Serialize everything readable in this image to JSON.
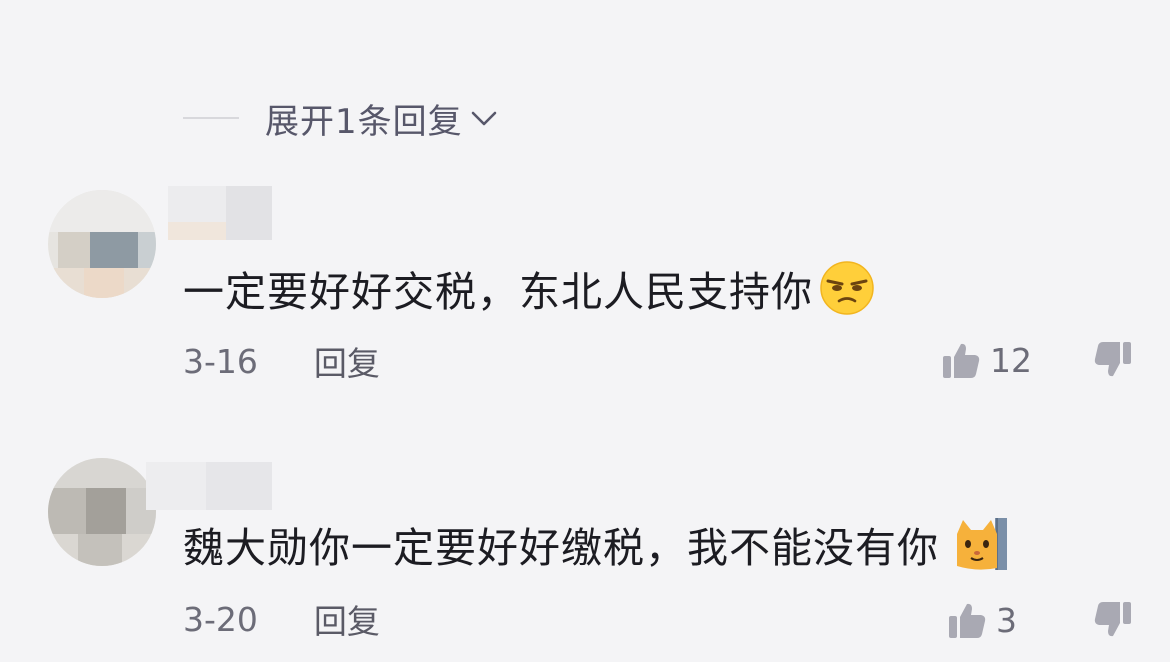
{
  "expand_replies": {
    "label": "展开1条回复"
  },
  "comments": [
    {
      "text": "一定要好好交税，东北人民支持你",
      "emoji": "grumpy-face-emoji",
      "date": "3-16",
      "reply_label": "回复",
      "likes": "12"
    },
    {
      "text": "魏大勋你一定要好好缴税，我不能没有你",
      "emoji": "cat-peeking-emoji",
      "date": "3-20",
      "reply_label": "回复",
      "likes": "3"
    }
  ],
  "colors": {
    "background": "#f4f4f6",
    "text": "#1c1c22",
    "meta": "#6c6c78",
    "icon": "#a9a9b3"
  }
}
